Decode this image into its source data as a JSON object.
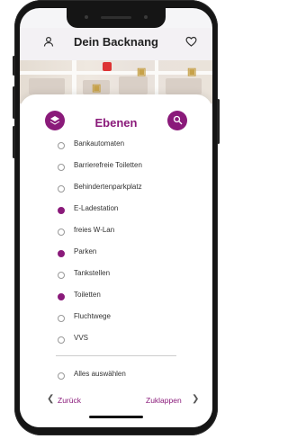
{
  "header": {
    "title": "Dein Backnang",
    "left_icon": "user-icon",
    "right_icon": "heart-icon"
  },
  "sheet": {
    "heading": "Ebenen",
    "left_icon": "layers-icon",
    "right_icon": "search-icon",
    "items": [
      {
        "label": "Bankautomaten",
        "selected": false
      },
      {
        "label": "Barrierefreie Toiletten",
        "selected": false
      },
      {
        "label": "Behindertenparkplatz",
        "selected": false
      },
      {
        "label": "E-Ladestation",
        "selected": true
      },
      {
        "label": "freies W-Lan",
        "selected": false
      },
      {
        "label": "Parken",
        "selected": true
      },
      {
        "label": "Tankstellen",
        "selected": false
      },
      {
        "label": "Toiletten",
        "selected": true
      },
      {
        "label": "Fluchtwege",
        "selected": false
      },
      {
        "label": "VVS",
        "selected": false
      }
    ],
    "select_all": {
      "label": "Alles auswählen",
      "selected": false
    },
    "back_label": "Zurück",
    "collapse_label": "Zuklappen"
  },
  "colors": {
    "accent": "#8a1a7a"
  }
}
